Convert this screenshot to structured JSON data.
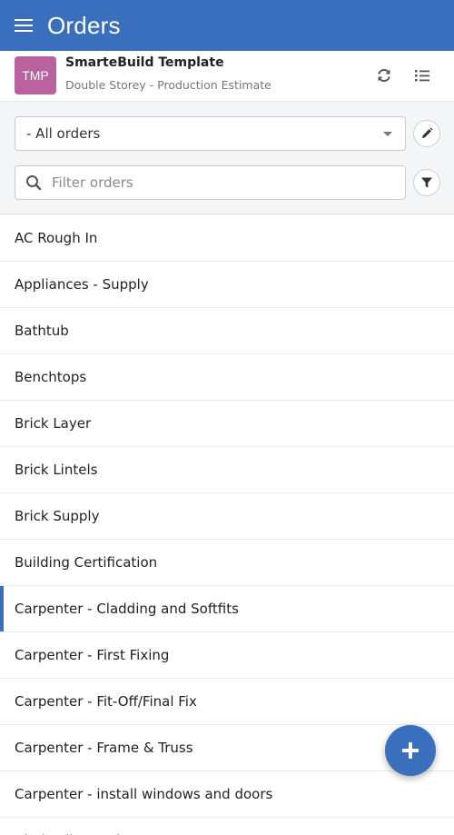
{
  "appbar": {
    "title": "Orders"
  },
  "project": {
    "avatar": "TMP",
    "name": "SmarteBuild Template",
    "subtitle": "Double Storey - Production Estimate"
  },
  "filters": {
    "selected": "- All orders",
    "search_placeholder": "Filter orders"
  },
  "orders": [
    "AC Rough In",
    "Appliances - Supply",
    "Bathtub",
    "Benchtops",
    "Brick Layer",
    "Brick Lintels",
    "Brick Supply",
    "Building Certification",
    "Carpenter - Cladding and Softfits",
    "Carpenter - First Fixing",
    "Carpenter - Fit-Off/Final Fix",
    "Carpenter - Frame & Truss",
    "Carpenter - install windows and doors",
    "Clothesline and Letter Box"
  ],
  "active_index": 8,
  "colors": {
    "primary": "#3a6fbd",
    "avatar": "#b9629f"
  },
  "icons": [
    "menu-icon",
    "refresh-icon",
    "list-icon",
    "edit-icon",
    "search-icon",
    "filter-icon",
    "plus-icon"
  ]
}
